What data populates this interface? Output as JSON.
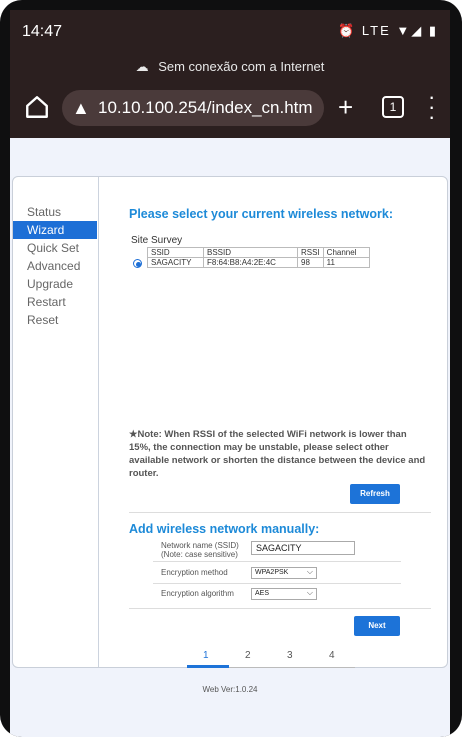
{
  "status_bar": {
    "time": "14:47",
    "icons": "⏰ LTE ▼◢ ▮"
  },
  "browser": {
    "offline_message": "Sem conexão com a Internet",
    "url": "10.10.100.254/index_cn.htm",
    "tab_count": "1"
  },
  "sidebar": {
    "items": [
      {
        "label": "Status"
      },
      {
        "label": "Wizard"
      },
      {
        "label": "Quick Set"
      },
      {
        "label": "Advanced"
      },
      {
        "label": "Upgrade"
      },
      {
        "label": "Restart"
      },
      {
        "label": "Reset"
      }
    ]
  },
  "main": {
    "select_heading": "Please select your current wireless network:",
    "site_survey_label": "Site Survey",
    "survey_columns": [
      "SSID",
      "BSSID",
      "RSSI",
      "Channel"
    ],
    "survey_rows": [
      {
        "ssid": "SAGACITY",
        "bssid": "F8:64:B8:A4:2E:4C",
        "rssi": "98",
        "channel": "11"
      }
    ],
    "note": "★Note: When RSSI of the selected WiFi network is lower than 15%, the connection may be unstable, please select other available network or shorten the distance between the device and router.",
    "refresh_label": "Refresh",
    "manual_heading": "Add wireless network manually:",
    "form": {
      "network_name_label": "Network name (SSID)",
      "network_name_note": "(Note: case sensitive)",
      "network_name_value": "SAGACITY",
      "encryption_method_label": "Encryption method",
      "encryption_method_value": "WPA2PSK",
      "encryption_algorithm_label": "Encryption algorithm",
      "encryption_algorithm_value": "AES"
    },
    "next_label": "Next",
    "steps": [
      "1",
      "2",
      "3",
      "4"
    ],
    "current_step": 1
  },
  "footer": {
    "version": "Web Ver:1.0.24"
  },
  "colors": {
    "accent": "#1d73d8",
    "heading": "#1d8ad8",
    "browser_bar": "#2b1f1f"
  }
}
